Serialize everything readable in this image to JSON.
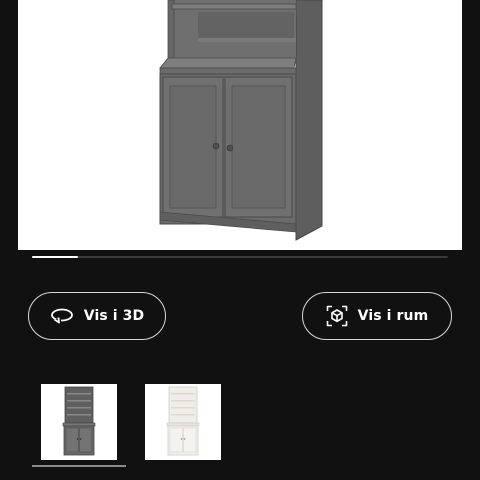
{
  "gallery": {
    "progress_fraction": 0.11
  },
  "actions": {
    "view_3d_label": "Vis i 3D",
    "view_in_room_label": "Vis i rum"
  },
  "thumbnails": [
    {
      "variant": "grey",
      "color": "#6b6b6b"
    },
    {
      "variant": "white",
      "color": "#f1f0ec"
    }
  ],
  "colors": {
    "background": "#111111",
    "cabinet_grey": "#6b6b6b",
    "cabinet_white": "#f1f0ec",
    "button_border": "#d8d8d8"
  }
}
